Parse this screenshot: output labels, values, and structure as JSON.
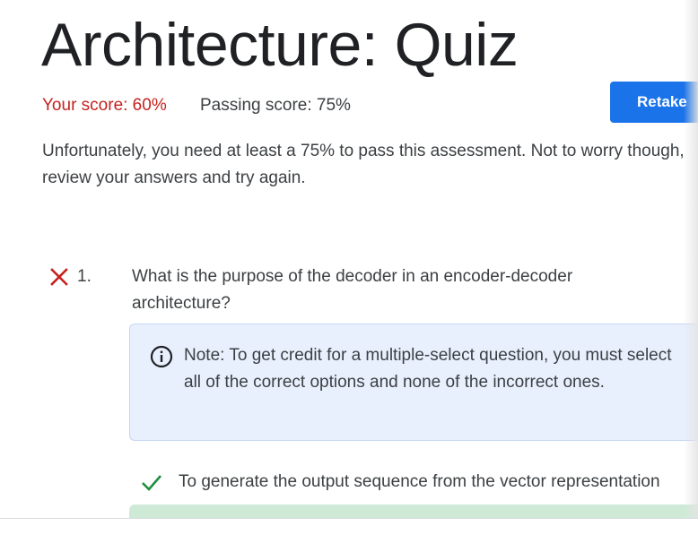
{
  "header": {
    "title": "Architecture: Quiz"
  },
  "scores": {
    "your_score": "Your score: 60%",
    "passing_score": "Passing score: 75%"
  },
  "actions": {
    "retake_label": "Retake"
  },
  "result": {
    "message": "Unfortunately, you need at least a 75% to pass this assessment. Not to worry though, review your answers and try again."
  },
  "question": {
    "status_icon": "x-incorrect-icon",
    "number": "1.",
    "text": "What is the purpose of the decoder in an encoder-decoder architecture?",
    "note_icon": "info-icon",
    "note": "Note: To get credit for a multiple-select question, you must select all of the correct options and none of the incorrect ones.",
    "options": [
      {
        "icon": "check-icon",
        "text": "To generate the output sequence from the vector representation"
      }
    ]
  },
  "colors": {
    "error": "#c5221f",
    "primary": "#1a73e8",
    "note_bg": "#e8f0fe",
    "success": "#1e8e3e",
    "success_bg": "#ceead6"
  }
}
